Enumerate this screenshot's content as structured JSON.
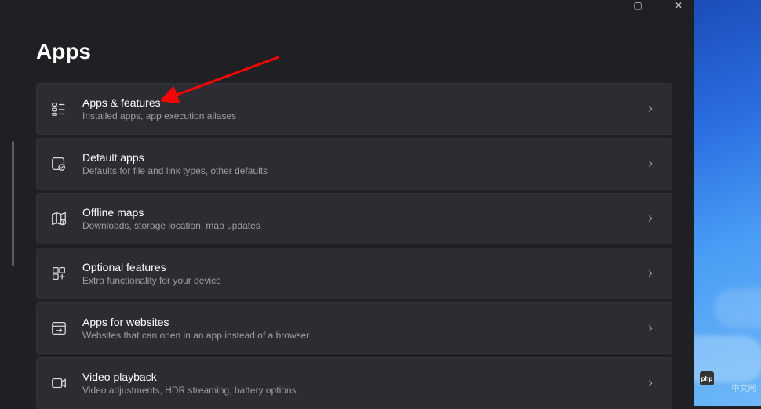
{
  "titlebar": {
    "maximize_symbol": "▢",
    "close_symbol": "✕"
  },
  "page": {
    "title": "Apps"
  },
  "items": [
    {
      "title": "Apps & features",
      "desc": "Installed apps, app execution aliases",
      "icon": "apps-features-icon"
    },
    {
      "title": "Default apps",
      "desc": "Defaults for file and link types, other defaults",
      "icon": "default-apps-icon"
    },
    {
      "title": "Offline maps",
      "desc": "Downloads, storage location, map updates",
      "icon": "offline-maps-icon"
    },
    {
      "title": "Optional features",
      "desc": "Extra functionality for your device",
      "icon": "optional-features-icon"
    },
    {
      "title": "Apps for websites",
      "desc": "Websites that can open in an app instead of a browser",
      "icon": "apps-websites-icon"
    },
    {
      "title": "Video playback",
      "desc": "Video adjustments, HDR streaming, battery options",
      "icon": "video-playback-icon"
    }
  ],
  "watermark": {
    "text": "中文网",
    "logo_text": "php"
  }
}
